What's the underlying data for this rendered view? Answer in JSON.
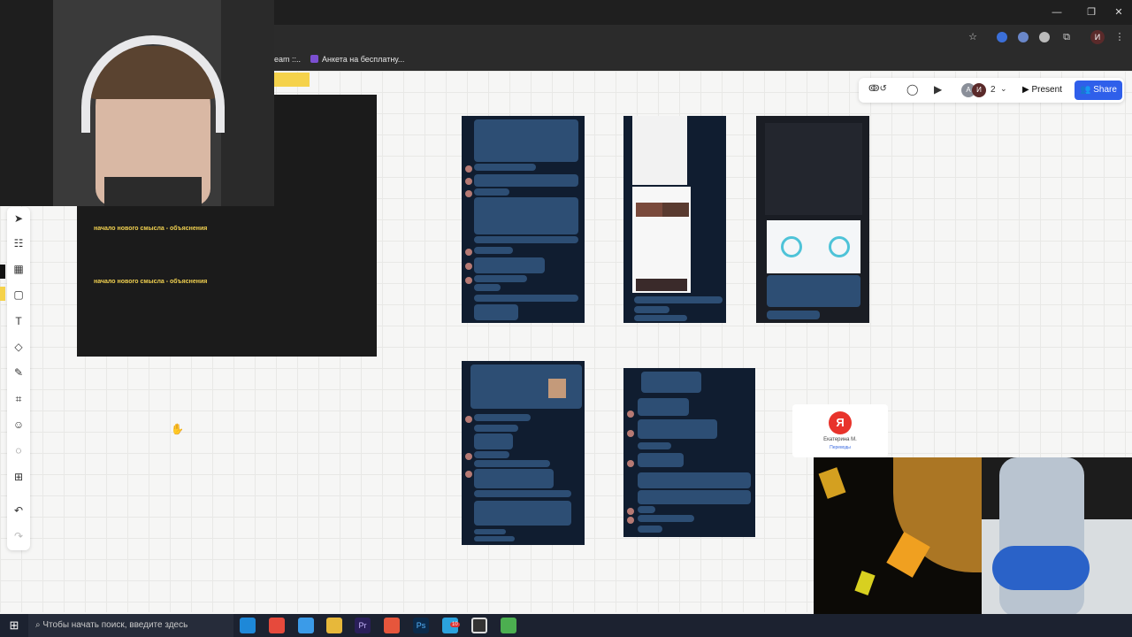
{
  "browser": {
    "bookmarks": [
      "eam ::..",
      "Анкета на бесплатну..."
    ],
    "profile_initial": "И"
  },
  "board": {
    "frame_lines": [
      "начало нового смысла - объяснения",
      "начало нового смысла - объяснения"
    ],
    "collaborators": {
      "count": "2",
      "initials": [
        "А",
        "И"
      ]
    },
    "present_label": "Present",
    "share_label": "Share",
    "yandex_card": {
      "logo": "Я",
      "name": "Екатерина М.",
      "sub": "Переводы"
    }
  },
  "taskbar": {
    "search_placeholder": "Чтобы начать поиск, введите здесь",
    "badge": "10"
  },
  "colors": {
    "accent": "#2f5fea",
    "frame_text": "#f0d050"
  },
  "icons": [
    "windows-icon",
    "search-icon",
    "edge-icon",
    "chrome-icon",
    "folder-icon",
    "premiere-icon",
    "photoshop-icon",
    "telegram-icon",
    "obs-icon"
  ]
}
